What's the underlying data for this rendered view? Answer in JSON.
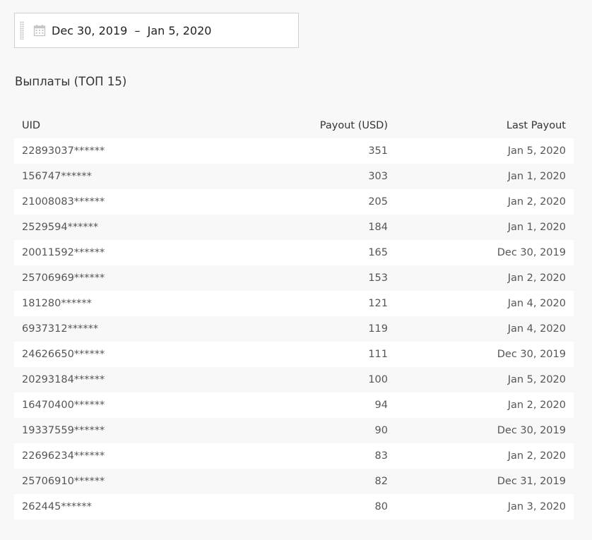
{
  "date_range": {
    "icon": "calendar-icon",
    "text": "Dec 30, 2019  –  Jan 5, 2020"
  },
  "section": {
    "title": "Выплаты (ТОП 15)"
  },
  "table": {
    "headers": {
      "uid": "UID",
      "payout": "Payout (USD)",
      "last_payout": "Last Payout"
    },
    "rows": [
      {
        "uid": "22893037******",
        "payout": "351",
        "last": "Jan 5, 2020"
      },
      {
        "uid": "156747******",
        "payout": "303",
        "last": "Jan 1, 2020"
      },
      {
        "uid": "21008083******",
        "payout": "205",
        "last": "Jan 2, 2020"
      },
      {
        "uid": "2529594******",
        "payout": "184",
        "last": "Jan 1, 2020"
      },
      {
        "uid": "20011592******",
        "payout": "165",
        "last": "Dec 30, 2019"
      },
      {
        "uid": "25706969******",
        "payout": "153",
        "last": "Jan 2, 2020"
      },
      {
        "uid": "181280******",
        "payout": "121",
        "last": "Jan 4, 2020"
      },
      {
        "uid": "6937312******",
        "payout": "119",
        "last": "Jan 4, 2020"
      },
      {
        "uid": "24626650******",
        "payout": "111",
        "last": "Dec 30, 2019"
      },
      {
        "uid": "20293184******",
        "payout": "100",
        "last": "Jan 5, 2020"
      },
      {
        "uid": "16470400******",
        "payout": "94",
        "last": "Jan 2, 2020"
      },
      {
        "uid": "19337559******",
        "payout": "90",
        "last": "Dec 30, 2019"
      },
      {
        "uid": "22696234******",
        "payout": "83",
        "last": "Jan 2, 2020"
      },
      {
        "uid": "25706910******",
        "payout": "82",
        "last": "Dec 31, 2019"
      },
      {
        "uid": "262445******",
        "payout": "80",
        "last": "Jan 3, 2020"
      }
    ]
  }
}
